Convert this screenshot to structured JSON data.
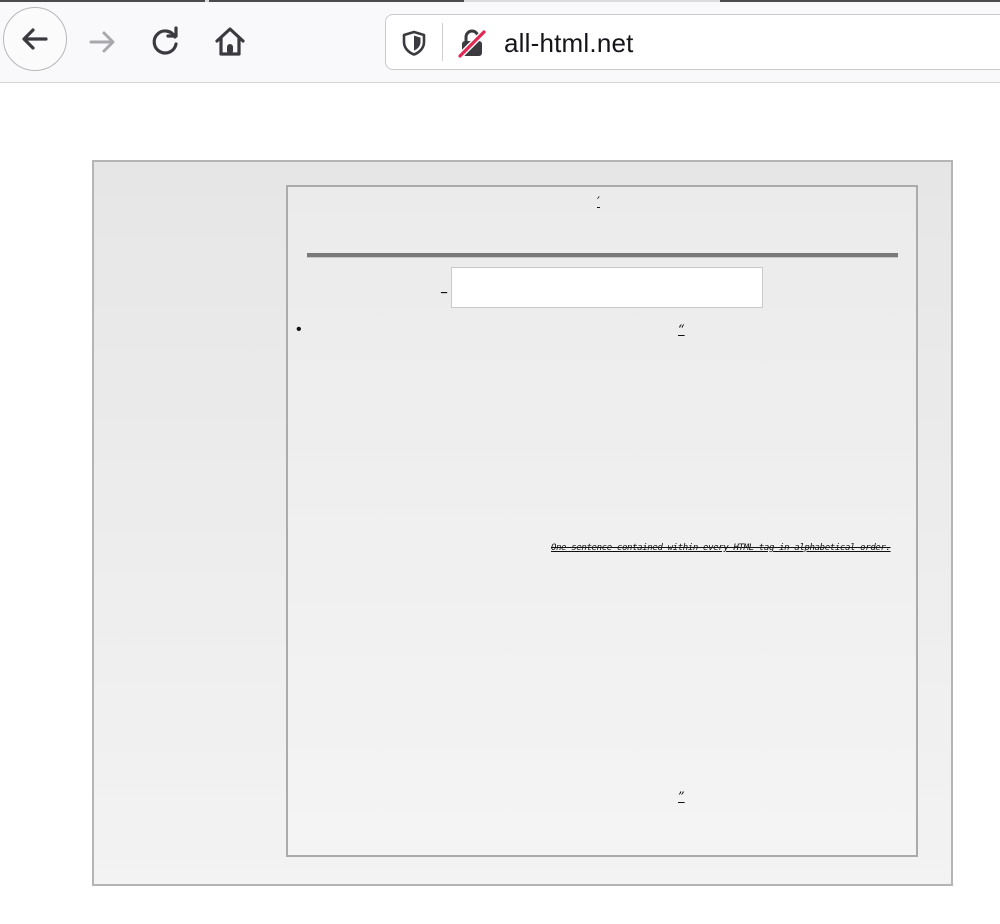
{
  "browser": {
    "url": "all-html.net",
    "icons": {
      "back": "back-arrow-icon",
      "forward": "forward-arrow-icon",
      "reload": "reload-icon",
      "home": "home-icon",
      "tracking": "shield-icon",
      "security": "insecure-lock-icon"
    },
    "colors": {
      "insecure_slash": "#e22850",
      "icon": "#3b3b3f",
      "icon_disabled": "#a8a8ad"
    }
  },
  "page": {
    "head_link": "′",
    "search_label": "_",
    "search_value": "",
    "bullet": "•",
    "quote_top": "“",
    "sentence": "One sentence contained within every HTML tag in alphabetical order.",
    "quote_bottom": "”"
  }
}
